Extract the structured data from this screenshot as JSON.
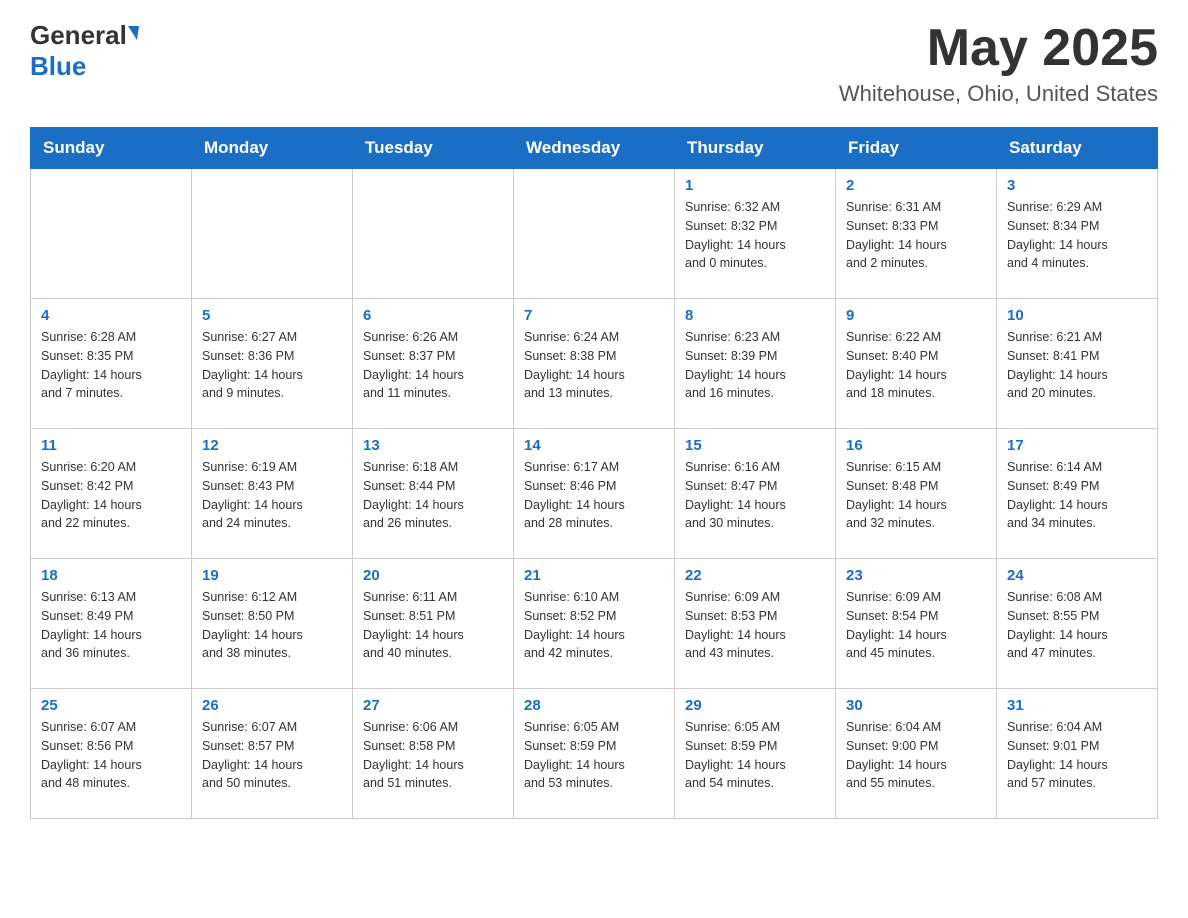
{
  "header": {
    "logo_general": "General",
    "logo_blue": "Blue",
    "month_title": "May 2025",
    "location": "Whitehouse, Ohio, United States"
  },
  "weekdays": [
    "Sunday",
    "Monday",
    "Tuesday",
    "Wednesday",
    "Thursday",
    "Friday",
    "Saturday"
  ],
  "weeks": [
    [
      {
        "day": "",
        "info": ""
      },
      {
        "day": "",
        "info": ""
      },
      {
        "day": "",
        "info": ""
      },
      {
        "day": "",
        "info": ""
      },
      {
        "day": "1",
        "info": "Sunrise: 6:32 AM\nSunset: 8:32 PM\nDaylight: 14 hours\nand 0 minutes."
      },
      {
        "day": "2",
        "info": "Sunrise: 6:31 AM\nSunset: 8:33 PM\nDaylight: 14 hours\nand 2 minutes."
      },
      {
        "day": "3",
        "info": "Sunrise: 6:29 AM\nSunset: 8:34 PM\nDaylight: 14 hours\nand 4 minutes."
      }
    ],
    [
      {
        "day": "4",
        "info": "Sunrise: 6:28 AM\nSunset: 8:35 PM\nDaylight: 14 hours\nand 7 minutes."
      },
      {
        "day": "5",
        "info": "Sunrise: 6:27 AM\nSunset: 8:36 PM\nDaylight: 14 hours\nand 9 minutes."
      },
      {
        "day": "6",
        "info": "Sunrise: 6:26 AM\nSunset: 8:37 PM\nDaylight: 14 hours\nand 11 minutes."
      },
      {
        "day": "7",
        "info": "Sunrise: 6:24 AM\nSunset: 8:38 PM\nDaylight: 14 hours\nand 13 minutes."
      },
      {
        "day": "8",
        "info": "Sunrise: 6:23 AM\nSunset: 8:39 PM\nDaylight: 14 hours\nand 16 minutes."
      },
      {
        "day": "9",
        "info": "Sunrise: 6:22 AM\nSunset: 8:40 PM\nDaylight: 14 hours\nand 18 minutes."
      },
      {
        "day": "10",
        "info": "Sunrise: 6:21 AM\nSunset: 8:41 PM\nDaylight: 14 hours\nand 20 minutes."
      }
    ],
    [
      {
        "day": "11",
        "info": "Sunrise: 6:20 AM\nSunset: 8:42 PM\nDaylight: 14 hours\nand 22 minutes."
      },
      {
        "day": "12",
        "info": "Sunrise: 6:19 AM\nSunset: 8:43 PM\nDaylight: 14 hours\nand 24 minutes."
      },
      {
        "day": "13",
        "info": "Sunrise: 6:18 AM\nSunset: 8:44 PM\nDaylight: 14 hours\nand 26 minutes."
      },
      {
        "day": "14",
        "info": "Sunrise: 6:17 AM\nSunset: 8:46 PM\nDaylight: 14 hours\nand 28 minutes."
      },
      {
        "day": "15",
        "info": "Sunrise: 6:16 AM\nSunset: 8:47 PM\nDaylight: 14 hours\nand 30 minutes."
      },
      {
        "day": "16",
        "info": "Sunrise: 6:15 AM\nSunset: 8:48 PM\nDaylight: 14 hours\nand 32 minutes."
      },
      {
        "day": "17",
        "info": "Sunrise: 6:14 AM\nSunset: 8:49 PM\nDaylight: 14 hours\nand 34 minutes."
      }
    ],
    [
      {
        "day": "18",
        "info": "Sunrise: 6:13 AM\nSunset: 8:49 PM\nDaylight: 14 hours\nand 36 minutes."
      },
      {
        "day": "19",
        "info": "Sunrise: 6:12 AM\nSunset: 8:50 PM\nDaylight: 14 hours\nand 38 minutes."
      },
      {
        "day": "20",
        "info": "Sunrise: 6:11 AM\nSunset: 8:51 PM\nDaylight: 14 hours\nand 40 minutes."
      },
      {
        "day": "21",
        "info": "Sunrise: 6:10 AM\nSunset: 8:52 PM\nDaylight: 14 hours\nand 42 minutes."
      },
      {
        "day": "22",
        "info": "Sunrise: 6:09 AM\nSunset: 8:53 PM\nDaylight: 14 hours\nand 43 minutes."
      },
      {
        "day": "23",
        "info": "Sunrise: 6:09 AM\nSunset: 8:54 PM\nDaylight: 14 hours\nand 45 minutes."
      },
      {
        "day": "24",
        "info": "Sunrise: 6:08 AM\nSunset: 8:55 PM\nDaylight: 14 hours\nand 47 minutes."
      }
    ],
    [
      {
        "day": "25",
        "info": "Sunrise: 6:07 AM\nSunset: 8:56 PM\nDaylight: 14 hours\nand 48 minutes."
      },
      {
        "day": "26",
        "info": "Sunrise: 6:07 AM\nSunset: 8:57 PM\nDaylight: 14 hours\nand 50 minutes."
      },
      {
        "day": "27",
        "info": "Sunrise: 6:06 AM\nSunset: 8:58 PM\nDaylight: 14 hours\nand 51 minutes."
      },
      {
        "day": "28",
        "info": "Sunrise: 6:05 AM\nSunset: 8:59 PM\nDaylight: 14 hours\nand 53 minutes."
      },
      {
        "day": "29",
        "info": "Sunrise: 6:05 AM\nSunset: 8:59 PM\nDaylight: 14 hours\nand 54 minutes."
      },
      {
        "day": "30",
        "info": "Sunrise: 6:04 AM\nSunset: 9:00 PM\nDaylight: 14 hours\nand 55 minutes."
      },
      {
        "day": "31",
        "info": "Sunrise: 6:04 AM\nSunset: 9:01 PM\nDaylight: 14 hours\nand 57 minutes."
      }
    ]
  ]
}
